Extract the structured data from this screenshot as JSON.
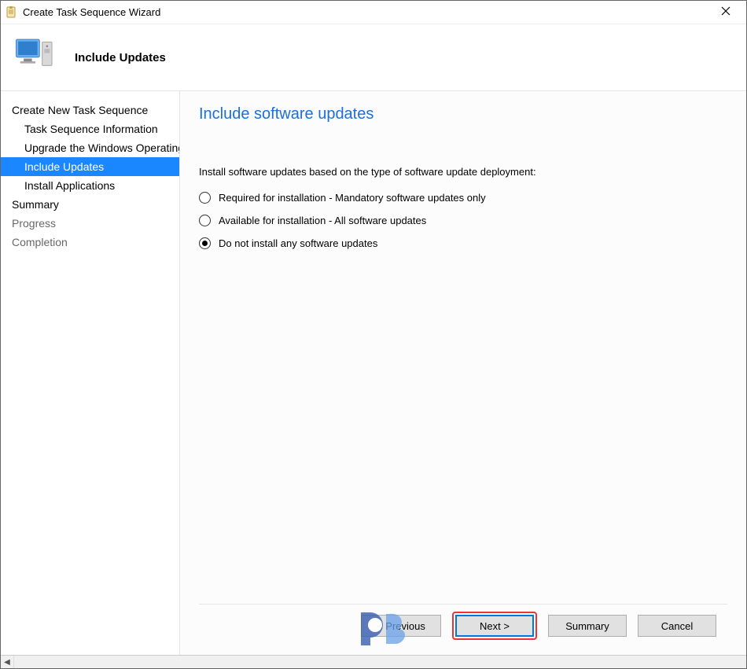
{
  "window": {
    "title": "Create Task Sequence Wizard"
  },
  "header": {
    "step_title": "Include Updates"
  },
  "sidebar": {
    "items": [
      {
        "label": "Create New Task Sequence",
        "indent": 0,
        "selected": false,
        "muted": false
      },
      {
        "label": "Task Sequence Information",
        "indent": 1,
        "selected": false,
        "muted": false
      },
      {
        "label": "Upgrade the Windows Operating System",
        "indent": 1,
        "selected": false,
        "muted": false
      },
      {
        "label": "Include Updates",
        "indent": 1,
        "selected": true,
        "muted": false
      },
      {
        "label": "Install Applications",
        "indent": 1,
        "selected": false,
        "muted": false
      },
      {
        "label": "Summary",
        "indent": 0,
        "selected": false,
        "muted": false
      },
      {
        "label": "Progress",
        "indent": 0,
        "selected": false,
        "muted": true
      },
      {
        "label": "Completion",
        "indent": 0,
        "selected": false,
        "muted": true
      }
    ]
  },
  "content": {
    "heading": "Include software updates",
    "instruction": "Install software updates based on the type of software update deployment:",
    "options": [
      {
        "label": "Required for installation - Mandatory software updates only",
        "selected": false
      },
      {
        "label": "Available for installation - All software updates",
        "selected": false
      },
      {
        "label": "Do not install any software updates",
        "selected": true
      }
    ]
  },
  "footer": {
    "previous": "< Previous",
    "next": "Next >",
    "summary": "Summary",
    "cancel": "Cancel"
  }
}
